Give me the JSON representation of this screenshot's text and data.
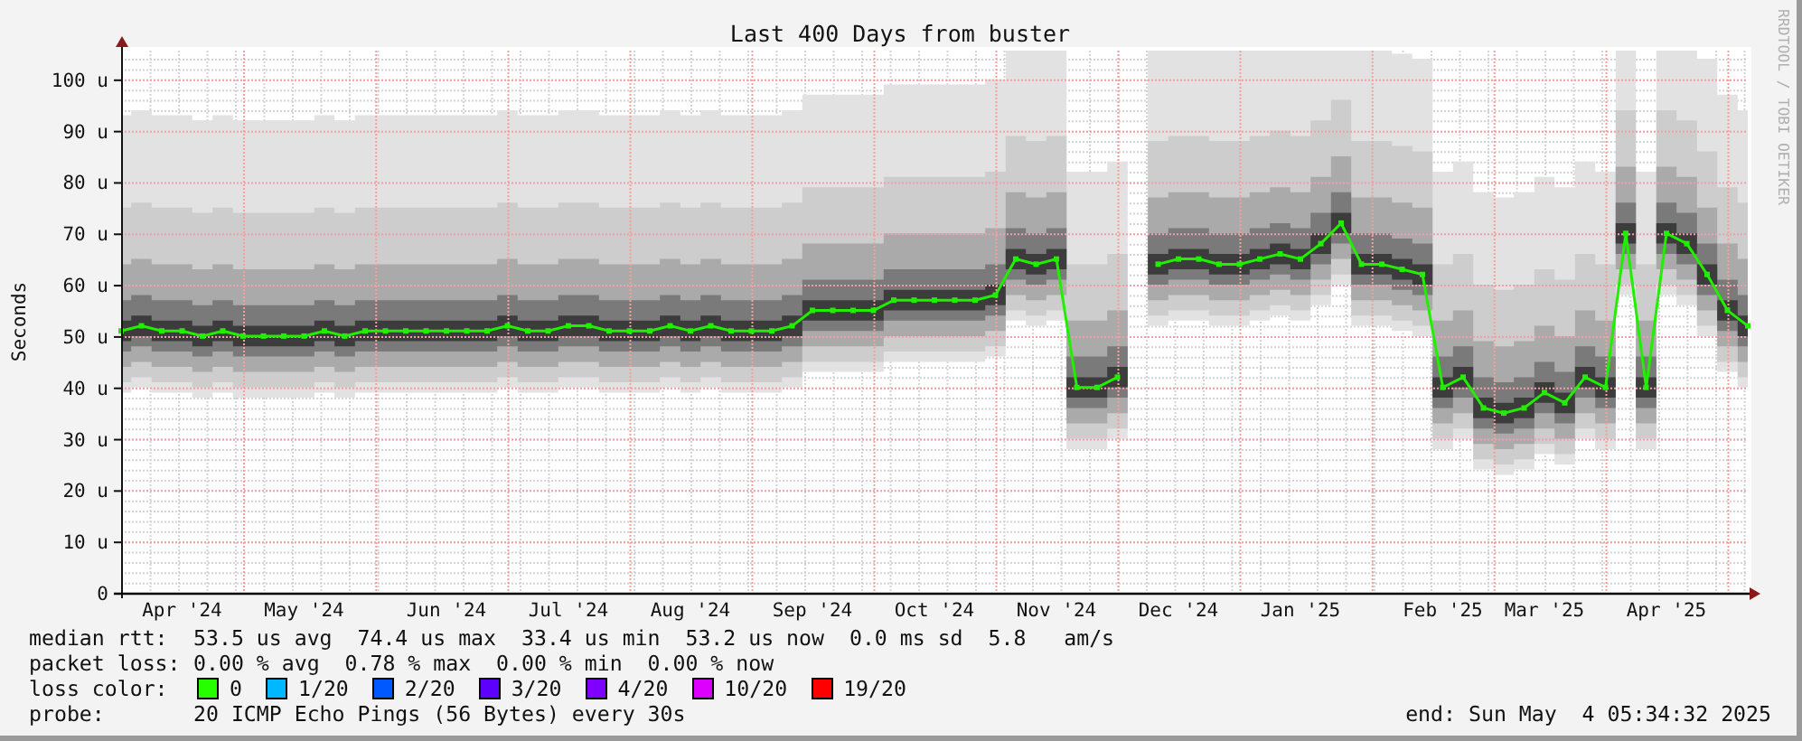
{
  "chart": {
    "credit": "RRDTOOL / TOBI OETIKER",
    "chart_data": {
      "type": "line",
      "grid": true,
      "title": "Last 400 Days from buster",
      "ylabel": "Seconds",
      "categories": [
        null,
        null,
        null,
        "Apr '24",
        null,
        null,
        null,
        null,
        null,
        "May '24",
        null,
        null,
        null,
        null,
        null,
        null,
        "Jun '24",
        null,
        null,
        null,
        null,
        null,
        "Jul '24",
        null,
        null,
        null,
        null,
        null,
        "Aug '24",
        null,
        null,
        null,
        null,
        null,
        "Sep '24",
        null,
        null,
        null,
        null,
        null,
        "Oct '24",
        null,
        null,
        null,
        null,
        null,
        "Nov '24",
        null,
        null,
        null,
        null,
        null,
        "Dec '24",
        null,
        null,
        null,
        null,
        null,
        "Jan '25",
        null,
        null,
        null,
        null,
        null,
        null,
        "Feb '25",
        null,
        null,
        null,
        null,
        "Mar '25",
        null,
        null,
        null,
        null,
        null,
        "Apr '25",
        null,
        null,
        null,
        null
      ],
      "ylim": [
        0,
        105.6
      ],
      "yticks": [
        {
          "value": 0,
          "label": "0"
        },
        {
          "value": 10,
          "label": "10 u"
        },
        {
          "value": 20,
          "label": "20 u"
        },
        {
          "value": 30,
          "label": "30 u"
        },
        {
          "value": 40,
          "label": "40 u"
        },
        {
          "value": 50,
          "label": "50 u"
        },
        {
          "value": 60,
          "label": "60 u"
        },
        {
          "value": 70,
          "label": "70 u"
        },
        {
          "value": 80,
          "label": "80 u"
        },
        {
          "value": 90,
          "label": "90 u"
        },
        {
          "value": 100,
          "label": "100 u"
        }
      ],
      "series": [
        {
          "name": "median rtt:",
          "color": "#22ee00",
          "marker": "square",
          "values": [
            51,
            52,
            51,
            51,
            50,
            51,
            50,
            50,
            50,
            50,
            51,
            50,
            51,
            51,
            51,
            51,
            51,
            51,
            51,
            52,
            51,
            51,
            52,
            52,
            51,
            51,
            51,
            52,
            51,
            52,
            51,
            51,
            51,
            52,
            55,
            55,
            55,
            55,
            57,
            57,
            57,
            57,
            57,
            58,
            65,
            64,
            65,
            40,
            40,
            42,
            null,
            64,
            65,
            65,
            64,
            64,
            65,
            66,
            65,
            68,
            72,
            64,
            64,
            63,
            62,
            40,
            42,
            36,
            35,
            36,
            39,
            37,
            42,
            40,
            70,
            40,
            70,
            68,
            62,
            55,
            52
          ]
        }
      ]
    }
  },
  "stats": [
    {
      "kind": "series",
      "text": "53.5 us avg  74.4 us max  33.4 us min  53.2 us now  0.0 ms sd  5.8   am/s"
    },
    {
      "kind": "plain",
      "label": "packet loss:",
      "text": "0.00 % avg  0.78 % max  0.00 % min  0.00 % now"
    }
  ],
  "loss_colors": {
    "label": "loss color:",
    "items": [
      {
        "label": "0",
        "color": "#26ff00"
      },
      {
        "label": "1/20",
        "color": "#00b8ff"
      },
      {
        "label": "2/20",
        "color": "#0059ff"
      },
      {
        "label": "3/20",
        "color": "#5e00ff"
      },
      {
        "label": "4/20",
        "color": "#7e00ff"
      },
      {
        "label": "10/20",
        "color": "#dd00ff"
      },
      {
        "label": "19/20",
        "color": "#ff0000"
      }
    ]
  },
  "probe": {
    "label": "probe:",
    "text": "20 ICMP Echo Pings (56 Bytes) every 30s"
  },
  "end": "end: Sun May  4 05:34:32 2025"
}
